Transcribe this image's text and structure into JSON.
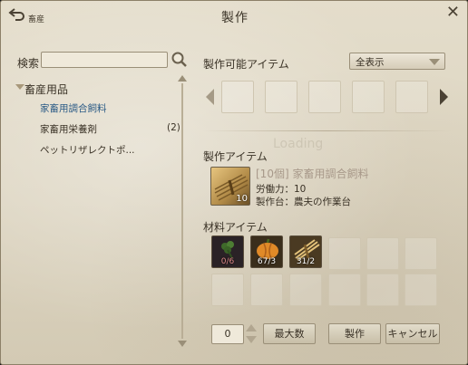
{
  "window": {
    "title": "製作",
    "breadcrumb": "畜産",
    "icons": {
      "back": "back-arrow-icon",
      "close": "close-icon"
    }
  },
  "search": {
    "label": "検索",
    "value": "",
    "placeholder": ""
  },
  "categories": {
    "group": "畜産用品",
    "items": [
      {
        "label": "家畜用調合飼料",
        "count": "",
        "selected": true
      },
      {
        "label": "家畜用栄養剤",
        "count": "(2)",
        "selected": false
      },
      {
        "label": "ペットリザレクトポ...",
        "count": "",
        "selected": false
      }
    ]
  },
  "craftable": {
    "heading": "製作可能アイテム",
    "filter": "全表示"
  },
  "watermark": "Loading",
  "product": {
    "heading": "製作アイテム",
    "name": "[10個] 家畜用調合飼料",
    "labor": "労働力：10",
    "workbench": "製作台：農夫の作業台",
    "quantity": "10",
    "icon": "hay-bundle-icon"
  },
  "materials": {
    "heading": "材料アイテム",
    "items": [
      {
        "icon": "clover-icon",
        "count": "0/6",
        "insufficient": true
      },
      {
        "icon": "pumpkin-icon",
        "count": "67/3",
        "insufficient": false
      },
      {
        "icon": "wheat-bundle-icon",
        "count": "31/2",
        "insufficient": false
      }
    ]
  },
  "footer": {
    "amount": "0",
    "max_button": "最大数",
    "craft_button": "製作",
    "cancel_button": "キャンセル"
  },
  "colors": {
    "panel_bg": "#e4ddcb",
    "selected_text": "#2b5b86",
    "insufficient": "#e08a8a"
  }
}
